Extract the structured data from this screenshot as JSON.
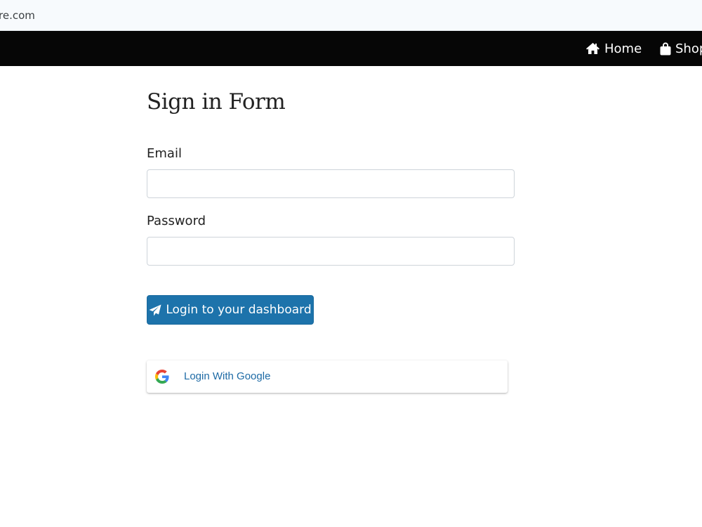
{
  "browser": {
    "domain_fragment": "re.com"
  },
  "navbar": {
    "items": [
      {
        "label": "Home",
        "icon": "home-icon"
      },
      {
        "label": "Shop",
        "icon": "shopping-bag-icon"
      }
    ],
    "background": "#060606"
  },
  "form": {
    "title": "Sign in Form",
    "email_label": "Email",
    "email_value": "",
    "password_label": "Password",
    "password_value": "",
    "login_button_label": "Login to your dashboard",
    "login_button_icon": "paper-plane-icon",
    "google_button_label": "Login With Google",
    "google_button_icon": "google-icon"
  },
  "colors": {
    "primary": "#1d73ab",
    "google_label": "#1d6aa5"
  }
}
